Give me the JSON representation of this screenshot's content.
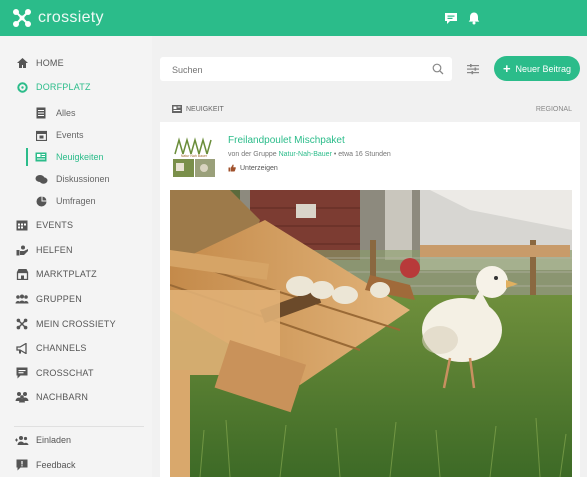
{
  "app": {
    "name": "crossiety",
    "brand_color": "#2bbc8a"
  },
  "topbar": {
    "icons": [
      "chat-icon",
      "bell-icon"
    ]
  },
  "sidebar": {
    "items": [
      {
        "label": "HOME",
        "icon": "home-icon"
      },
      {
        "label": "DORFPLATZ",
        "icon": "dorfplatz-icon",
        "active": true
      },
      {
        "label": "EVENTS",
        "icon": "calendar-icon"
      },
      {
        "label": "HELFEN",
        "icon": "helping-hand-icon"
      },
      {
        "label": "MARKTPLATZ",
        "icon": "store-icon"
      },
      {
        "label": "GRUPPEN",
        "icon": "group-icon"
      },
      {
        "label": "MEIN CROSSIETY",
        "icon": "crossiety-icon"
      },
      {
        "label": "CHANNELS",
        "icon": "megaphone-icon"
      },
      {
        "label": "CROSSCHAT",
        "icon": "chat-icon"
      },
      {
        "label": "NACHBARN",
        "icon": "neighbors-icon"
      }
    ],
    "subitems": [
      {
        "label": "Alles",
        "icon": "list-icon"
      },
      {
        "label": "Events",
        "icon": "calendar-icon"
      },
      {
        "label": "Neuigkeiten",
        "icon": "news-icon",
        "active": true
      },
      {
        "label": "Diskussionen",
        "icon": "discussion-icon"
      },
      {
        "label": "Umfragen",
        "icon": "poll-icon"
      }
    ],
    "bottom": [
      {
        "label": "Einladen",
        "icon": "invite-icon"
      },
      {
        "label": "Feedback",
        "icon": "feedback-icon"
      }
    ]
  },
  "search": {
    "placeholder": "Suchen"
  },
  "new_post": {
    "label": "Neuer Beitrag"
  },
  "post": {
    "type": "NEUIGKEIT",
    "scope": "REGIONAL",
    "title": "Freilandpoulet Mischpaket",
    "meta_prefix": "von der Gruppe ",
    "group": "Natur-Nah-Bauer",
    "meta_suffix": " • etwa 16 Stunden",
    "status": "Unterzeigen"
  }
}
